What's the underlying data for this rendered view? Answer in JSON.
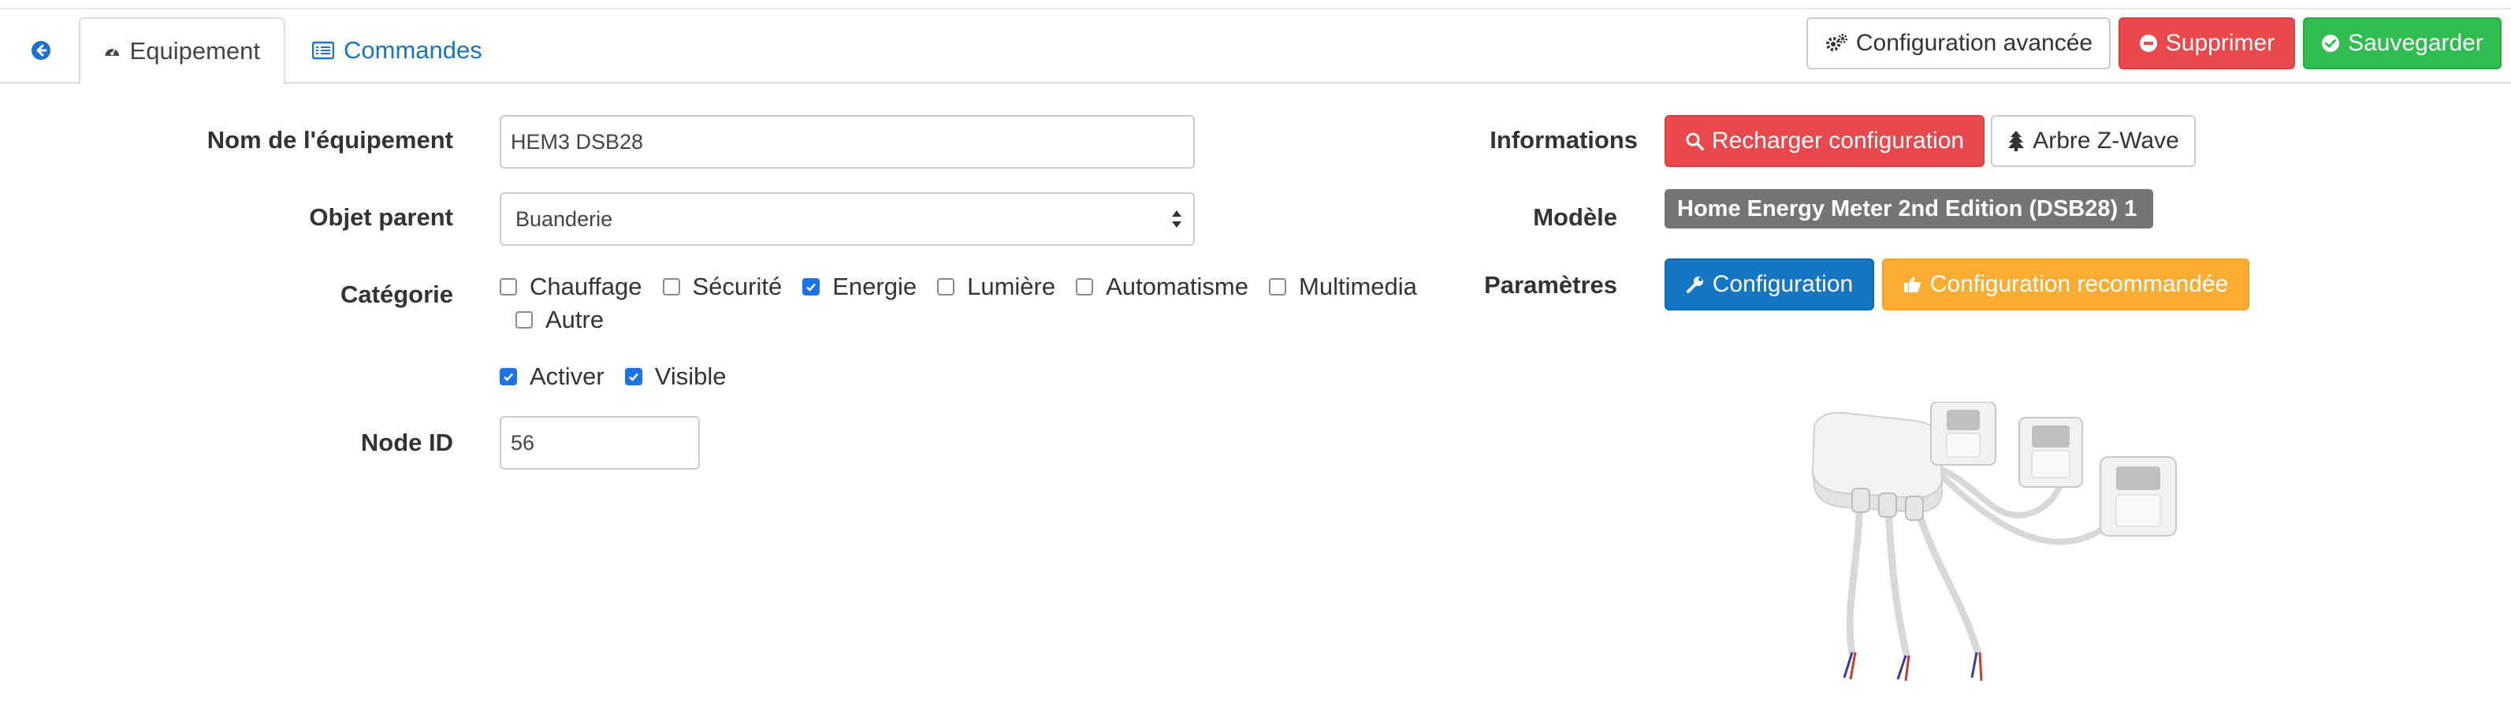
{
  "tabs": {
    "back_icon": "circle-arrow-left-icon",
    "equipement": {
      "label": "Equipement",
      "icon": "dashboard-icon"
    },
    "commandes": {
      "label": "Commandes",
      "icon": "list-icon"
    }
  },
  "toolbar": {
    "advanced_config": {
      "label": "Configuration avancée",
      "icon": "cogs-icon"
    },
    "delete": {
      "label": "Supprimer",
      "icon": "minus-circle-icon"
    },
    "save": {
      "label": "Sauvegarder",
      "icon": "check-circle-icon"
    }
  },
  "form": {
    "name_label": "Nom de l'équipement",
    "name_value": "HEM3 DSB28",
    "parent_label": "Objet parent",
    "parent_value": "Buanderie",
    "category_label": "Catégorie",
    "categories": [
      {
        "label": "Chauffage",
        "checked": false
      },
      {
        "label": "Sécurité",
        "checked": false
      },
      {
        "label": "Energie",
        "checked": true
      },
      {
        "label": "Lumière",
        "checked": false
      },
      {
        "label": "Automatisme",
        "checked": false
      },
      {
        "label": "Multimedia",
        "checked": false
      },
      {
        "label": "Autre",
        "checked": false
      }
    ],
    "activate_label": "Activer",
    "activate_checked": true,
    "visible_label": "Visible",
    "visible_checked": true,
    "node_label": "Node ID",
    "node_value": "56"
  },
  "info": {
    "informations_label": "Informations",
    "reload_config": {
      "label": "Recharger configuration",
      "icon": "search-icon"
    },
    "zwave_tree": {
      "label": "Arbre Z-Wave",
      "icon": "tree-icon"
    },
    "model_label": "Modèle",
    "model_value": "Home Energy Meter 2nd Edition (DSB28) 1",
    "params_label": "Paramètres",
    "configuration": {
      "label": "Configuration",
      "icon": "wrench-icon"
    },
    "recommended": {
      "label": "Configuration recommandée",
      "icon": "thumbs-up-icon"
    }
  },
  "colors": {
    "link": "#1a73c8",
    "danger": "#e9484c",
    "success": "#2ebd4e",
    "primary": "#1577c4",
    "warning": "#fbad33",
    "badge": "#757575"
  }
}
